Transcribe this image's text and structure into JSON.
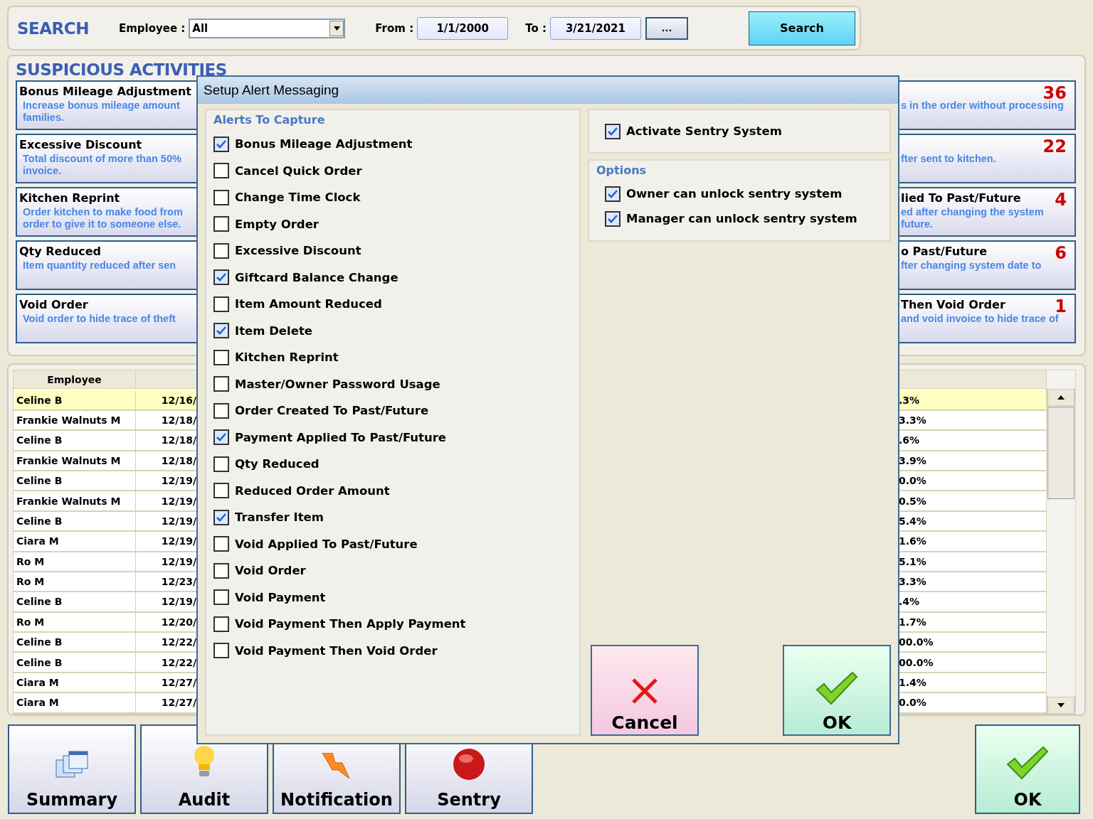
{
  "search": {
    "title": "SEARCH",
    "employee_label": "Employee :",
    "employee_value": "All",
    "from_label": "From :",
    "from_value": "1/1/2000",
    "to_label": "To :",
    "to_value": "3/21/2021",
    "picker_button": "...",
    "search_button": "Search"
  },
  "activities": {
    "title": "SUSPICIOUS ACTIVITIES",
    "left_cards": [
      {
        "title": "Bonus Mileage Adjustment",
        "description": [
          "Increase  bonus mileage amount",
          "families."
        ]
      },
      {
        "title": "Excessive Discount",
        "description": [
          "Total discount of more than 50%",
          "invoice."
        ]
      },
      {
        "title": "Kitchen Reprint",
        "description": [
          "Order kitchen to make food from",
          "order to give it to someone else."
        ]
      },
      {
        "title": "Qty Reduced",
        "description": [
          "Item quantity reduced after sen"
        ]
      },
      {
        "title": "Void Order",
        "description": [
          "Void order to hide trace of theft"
        ]
      }
    ],
    "right_cards": [
      {
        "description": [
          "s in the order without processing"
        ],
        "count": "36"
      },
      {
        "description": [
          "fter sent to kitchen."
        ],
        "count": "22"
      },
      {
        "title": "lied To Past/Future",
        "description": [
          "ed after changing the system",
          "future."
        ],
        "count": "4"
      },
      {
        "title": "o Past/Future",
        "description": [
          "fter changing system date to"
        ],
        "count": "6"
      },
      {
        "title": "Then Void Order",
        "description": [
          "and void invoice to hide trace of"
        ],
        "count": "1"
      }
    ]
  },
  "table": {
    "columns": [
      "Employee"
    ],
    "rows": [
      {
        "employee": "Celine B",
        "date": "12/16/",
        "percent": ".3%",
        "selected": true
      },
      {
        "employee": "Frankie Walnuts M",
        "date": "12/18/",
        "percent": "3.3%",
        "selected": false
      },
      {
        "employee": "Celine B",
        "date": "12/18/",
        "percent": ".6%",
        "selected": false
      },
      {
        "employee": "Frankie Walnuts M",
        "date": "12/18/",
        "percent": "3.9%",
        "selected": false
      },
      {
        "employee": "Celine B",
        "date": "12/19/",
        "percent": "0.0%",
        "selected": false
      },
      {
        "employee": "Frankie Walnuts M",
        "date": "12/19/",
        "percent": "0.5%",
        "selected": false
      },
      {
        "employee": "Celine B",
        "date": "12/19/",
        "percent": "5.4%",
        "selected": false
      },
      {
        "employee": "Ciara M",
        "date": "12/19/",
        "percent": "1.6%",
        "selected": false
      },
      {
        "employee": "Ro M",
        "date": "12/19/",
        "percent": "5.1%",
        "selected": false
      },
      {
        "employee": "Ro M",
        "date": "12/23/",
        "percent": "3.3%",
        "selected": false
      },
      {
        "employee": "Celine B",
        "date": "12/19/",
        "percent": ".4%",
        "selected": false
      },
      {
        "employee": "Ro M",
        "date": "12/20/",
        "percent": "1.7%",
        "selected": false
      },
      {
        "employee": "Celine B",
        "date": "12/22/",
        "percent": "00.0%",
        "selected": false
      },
      {
        "employee": "Celine B",
        "date": "12/22/",
        "percent": "00.0%",
        "selected": false
      },
      {
        "employee": "Ciara M",
        "date": "12/27/",
        "percent": "1.4%",
        "selected": false
      },
      {
        "employee": "Ciara M",
        "date": "12/27/",
        "percent": "0.0%",
        "selected": false
      }
    ]
  },
  "nav_buttons": [
    {
      "label": "Summary",
      "kind": "summary"
    },
    {
      "label": "Audit",
      "kind": "audit"
    },
    {
      "label": "Notification",
      "kind": "notification"
    },
    {
      "label": "Sentry",
      "kind": "sentry"
    }
  ],
  "ok_button": "OK",
  "dialog": {
    "title": "Setup Alert Messaging",
    "alerts_title": "Alerts To Capture",
    "alerts": [
      {
        "label": "Bonus Mileage Adjustment",
        "checked": true
      },
      {
        "label": "Cancel Quick Order",
        "checked": false
      },
      {
        "label": "Change Time Clock",
        "checked": false
      },
      {
        "label": "Empty Order",
        "checked": false
      },
      {
        "label": "Excessive Discount",
        "checked": false
      },
      {
        "label": "Giftcard Balance Change",
        "checked": true
      },
      {
        "label": "Item Amount Reduced",
        "checked": false
      },
      {
        "label": "Item Delete",
        "checked": true
      },
      {
        "label": "Kitchen Reprint",
        "checked": false
      },
      {
        "label": "Master/Owner Password Usage",
        "checked": false
      },
      {
        "label": "Order Created To Past/Future",
        "checked": false
      },
      {
        "label": "Payment Applied To Past/Future",
        "checked": true
      },
      {
        "label": "Qty Reduced",
        "checked": false
      },
      {
        "label": "Reduced Order Amount",
        "checked": false
      },
      {
        "label": "Transfer Item",
        "checked": true
      },
      {
        "label": "Void Applied To Past/Future",
        "checked": false
      },
      {
        "label": "Void Order",
        "checked": false
      },
      {
        "label": "Void Payment",
        "checked": false
      },
      {
        "label": "Void Payment Then Apply Payment",
        "checked": false
      },
      {
        "label": "Void Payment Then Void Order",
        "checked": false
      }
    ],
    "activate": {
      "label": "Activate Sentry System",
      "checked": true
    },
    "options_title": "Options",
    "options": [
      {
        "label": "Owner can unlock sentry system",
        "checked": true
      },
      {
        "label": "Manager can unlock sentry system",
        "checked": true
      }
    ],
    "cancel_button": "Cancel",
    "ok_button": "OK"
  }
}
